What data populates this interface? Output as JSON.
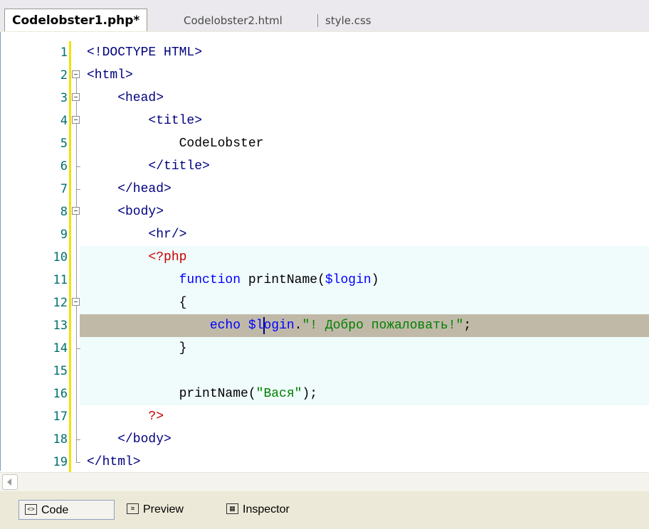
{
  "tabs": [
    {
      "label": "Codelobster1.php*",
      "active": true
    },
    {
      "label": "Codelobster2.html",
      "active": false
    },
    {
      "label": "style.css",
      "active": false
    }
  ],
  "lines": [
    {
      "n": "1",
      "code": [
        [
          "<!DOCTYPE HTML>",
          "tag"
        ]
      ]
    },
    {
      "n": "2",
      "code": [
        [
          "<html>",
          "tag"
        ]
      ]
    },
    {
      "n": "3",
      "code": [
        [
          "    <head>",
          "tag"
        ]
      ]
    },
    {
      "n": "4",
      "code": [
        [
          "        <title>",
          "tag"
        ]
      ]
    },
    {
      "n": "5",
      "code": [
        [
          "            CodeLobster",
          "dark"
        ]
      ]
    },
    {
      "n": "6",
      "code": [
        [
          "        </title>",
          "tag"
        ]
      ]
    },
    {
      "n": "7",
      "code": [
        [
          "    </head>",
          "tag"
        ]
      ]
    },
    {
      "n": "8",
      "code": [
        [
          "    <body>",
          "tag"
        ]
      ]
    },
    {
      "n": "9",
      "code": [
        [
          "        <hr/>",
          "tag"
        ]
      ]
    },
    {
      "n": "10",
      "code": [
        [
          "        <?php",
          "php"
        ]
      ]
    },
    {
      "n": "11",
      "code": [
        [
          "            ",
          "dark"
        ],
        [
          "function",
          "key"
        ],
        [
          " printName(",
          "dark"
        ],
        [
          "$login",
          "var"
        ],
        [
          ")",
          "dark"
        ]
      ]
    },
    {
      "n": "12",
      "code": [
        [
          "            {",
          "dark"
        ]
      ]
    },
    {
      "n": "13",
      "code": [
        [
          "                ",
          "dark"
        ],
        [
          "echo",
          "key"
        ],
        [
          " ",
          "dark"
        ],
        [
          "$login",
          "var"
        ],
        [
          ".",
          "dark"
        ],
        [
          "\"! Добро пожаловать!\"",
          "str"
        ],
        [
          ";",
          "dark"
        ]
      ]
    },
    {
      "n": "14",
      "code": [
        [
          "            }",
          "dark"
        ]
      ]
    },
    {
      "n": "15",
      "code": [
        [
          "",
          "dark"
        ]
      ]
    },
    {
      "n": "16",
      "code": [
        [
          "            printName(",
          "dark"
        ],
        [
          "\"Вася\"",
          "str"
        ],
        [
          ");",
          "dark"
        ]
      ]
    },
    {
      "n": "17",
      "code": [
        [
          "        ?>",
          "php"
        ]
      ]
    },
    {
      "n": "18",
      "code": [
        [
          "    </body>",
          "tag"
        ]
      ]
    },
    {
      "n": "19",
      "code": [
        [
          "</html>",
          "tag"
        ]
      ]
    }
  ],
  "views": [
    {
      "label": "Code",
      "icon": "code-view-icon",
      "active": true
    },
    {
      "label": "Preview",
      "icon": "preview-icon",
      "active": false
    },
    {
      "label": "Inspector",
      "icon": "inspector-icon",
      "active": false
    }
  ]
}
